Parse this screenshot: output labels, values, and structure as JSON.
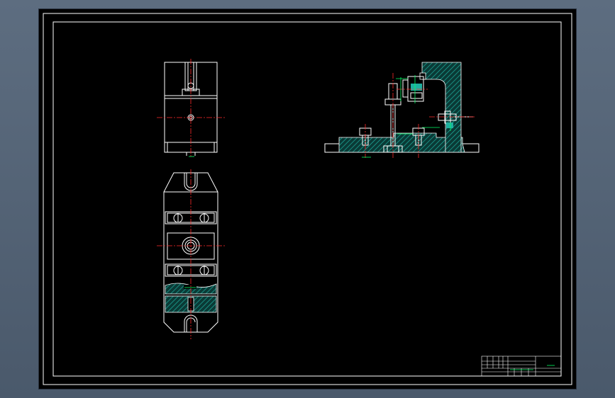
{
  "colors": {
    "background": "#000000",
    "outline": "#ffffff",
    "centerline": "#ff2a2a",
    "annotation": "#00ff66",
    "hatch": "#1fb0a0"
  },
  "views": {
    "top_view_label": "",
    "plan_view_label": "",
    "front_view_label": ""
  },
  "title_block": {
    "drawing_title": ""
  }
}
